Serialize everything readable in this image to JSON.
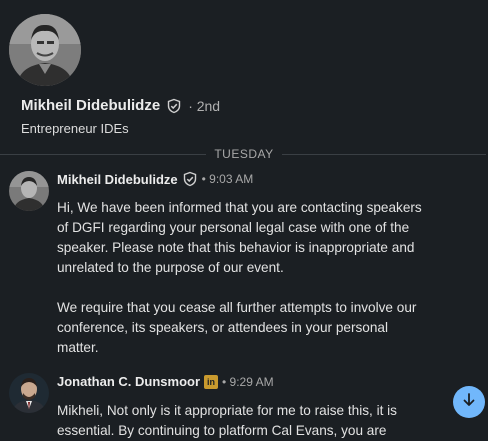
{
  "profile": {
    "name": "Mikheil Didebulidze",
    "degree": "· 2nd",
    "headline": "Entrepreneur IDEs"
  },
  "divider": {
    "label": "TUESDAY"
  },
  "messages": [
    {
      "sender": "Mikheil Didebulidze",
      "time": "• 9:03 AM",
      "paragraphs": [
        "Hi, We have been informed that you are contacting speakers of DGFI regarding your personal legal case with one of the speaker. Please note that this behavior is inappropriate and unrelated to the purpose of our event.",
        "We require that you cease all further attempts to involve our conference, its speakers, or attendees in your personal matter."
      ]
    },
    {
      "sender": "Jonathan C. Dunsmoor",
      "time": "• 9:29 AM",
      "badge": "in",
      "paragraphs": [
        "Mikheli, Not only is it appropriate for me to raise this, it is essential. By continuing to platform Cal Evans, you are"
      ]
    }
  ],
  "icons": {
    "verified": "shield-check-icon",
    "linkedin": "linkedin-icon",
    "scroll": "arrow-down-icon"
  },
  "colors": {
    "background": "#1b1f23",
    "accent": "#71b7fb",
    "premium_badge": "#c99a2e"
  }
}
